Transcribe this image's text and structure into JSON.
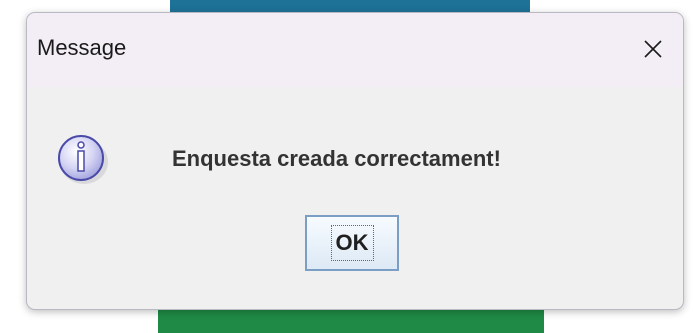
{
  "dialog": {
    "title": "Message",
    "message": "Enquesta creada correctament!",
    "ok_label": "OK",
    "icon": "info-icon",
    "close_icon": "close-icon"
  },
  "colors": {
    "backdrop_top": "#1e7197",
    "backdrop_bottom": "#1f8a45",
    "dialog_bg": "#f0f0f0",
    "titlebar_bg": "#f3eef6",
    "icon_fill": "#c8c8f0",
    "icon_stroke": "#4848a8"
  }
}
